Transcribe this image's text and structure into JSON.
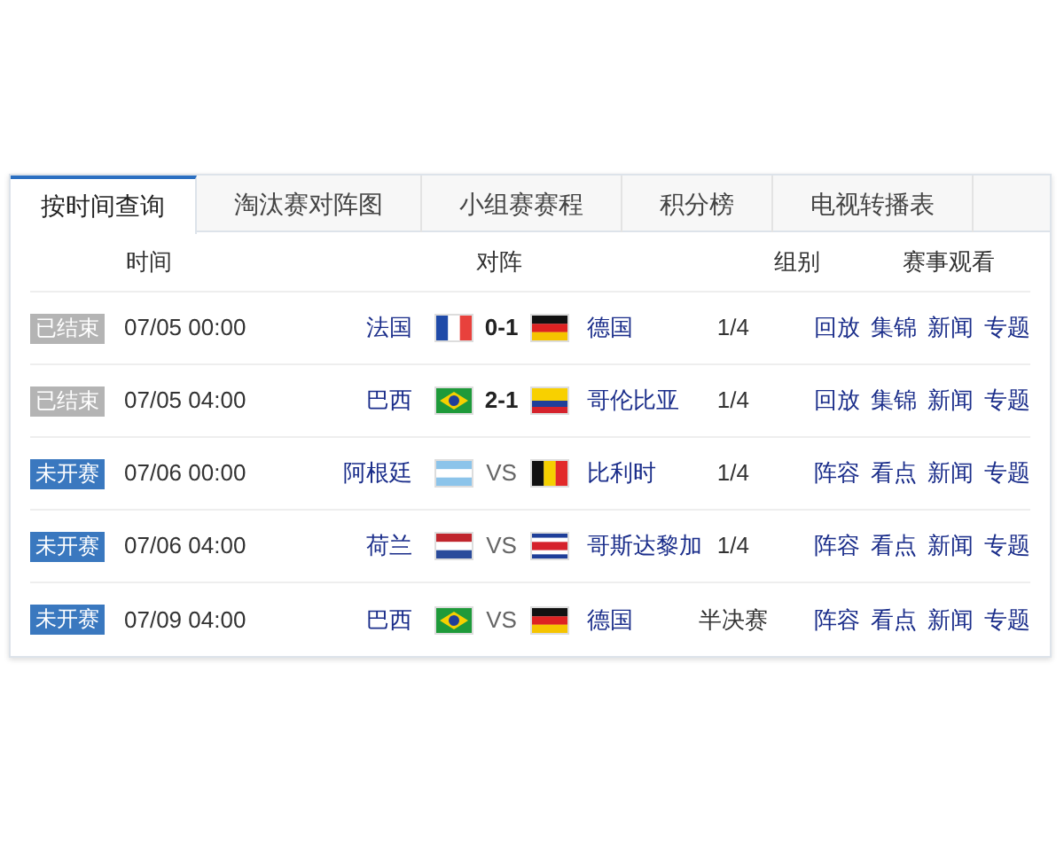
{
  "tabs": [
    {
      "label": "按时间查询",
      "selected": true
    },
    {
      "label": "淘汰赛对阵图",
      "selected": false
    },
    {
      "label": "小组赛赛程",
      "selected": false
    },
    {
      "label": "积分榜",
      "selected": false
    },
    {
      "label": "电视转播表",
      "selected": false
    }
  ],
  "columns": [
    "时间",
    "对阵",
    "组别",
    "赛事观看"
  ],
  "rows": [
    {
      "status": {
        "label": "已结束",
        "kind": "finished"
      },
      "time": "07/05 00:00",
      "home": {
        "name": "法国",
        "kind": "fr"
      },
      "score": "0-1",
      "away": {
        "name": "德国",
        "kind": "de"
      },
      "group": "1/4",
      "links": [
        "回放",
        "集锦",
        "新闻",
        "专题"
      ]
    },
    {
      "status": {
        "label": "已结束",
        "kind": "finished"
      },
      "time": "07/05 04:00",
      "home": {
        "name": "巴西",
        "kind": "br"
      },
      "score": "2-1",
      "away": {
        "name": "哥伦比亚",
        "kind": "co"
      },
      "group": "1/4",
      "links": [
        "回放",
        "集锦",
        "新闻",
        "专题"
      ]
    },
    {
      "status": {
        "label": "未开赛",
        "kind": "upcoming"
      },
      "time": "07/06 00:00",
      "home": {
        "name": "阿根廷",
        "kind": "ar"
      },
      "score": "VS",
      "away": {
        "name": "比利时",
        "kind": "be"
      },
      "group": "1/4",
      "links": [
        "阵容",
        "看点",
        "新闻",
        "专题"
      ]
    },
    {
      "status": {
        "label": "未开赛",
        "kind": "upcoming"
      },
      "time": "07/06 04:00",
      "home": {
        "name": "荷兰",
        "kind": "nl"
      },
      "score": "VS",
      "away": {
        "name": "哥斯达黎加",
        "kind": "cr"
      },
      "group": "1/4",
      "links": [
        "阵容",
        "看点",
        "新闻",
        "专题"
      ]
    },
    {
      "status": {
        "label": "未开赛",
        "kind": "upcoming"
      },
      "time": "07/09 04:00",
      "home": {
        "name": "巴西",
        "kind": "br"
      },
      "score": "VS",
      "away": {
        "name": "德国",
        "kind": "de"
      },
      "group": "半决赛",
      "links": [
        "阵容",
        "看点",
        "新闻",
        "专题"
      ]
    }
  ]
}
